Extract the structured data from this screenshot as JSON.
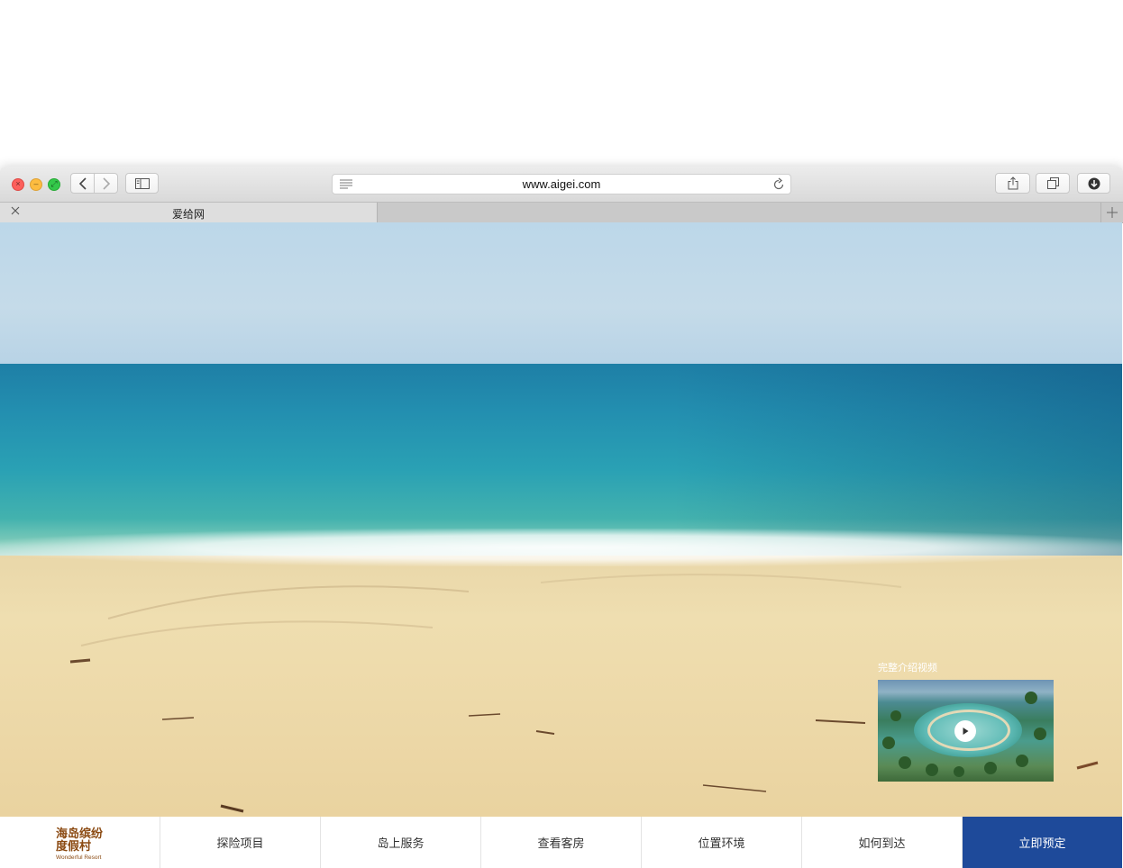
{
  "browser": {
    "url": "www.aigei.com",
    "tab_title": "爱给网",
    "buttons": {
      "back": "chevron-left-icon",
      "forward": "chevron-right-icon",
      "sidebar": "sidebar-icon",
      "share": "share-icon",
      "tabs": "tabs-icon",
      "download": "download-icon",
      "reader": "reader-icon",
      "reload": "reload-icon",
      "new_tab": "plus-icon",
      "close_tab": "close-icon"
    }
  },
  "hero": {
    "video_label": "完整介绍视频",
    "play_icon": "play-icon"
  },
  "logo": {
    "name_cn": "海岛缤纷度假村",
    "name_en": "Wonderful Resort"
  },
  "nav": {
    "items": [
      "探险项目",
      "岛上服务",
      "查看客房",
      "位置环境",
      "如何到达"
    ],
    "cta": "立即预定"
  },
  "colors": {
    "cta_bg": "#1e4a9a",
    "logo": "#8b4a12"
  }
}
